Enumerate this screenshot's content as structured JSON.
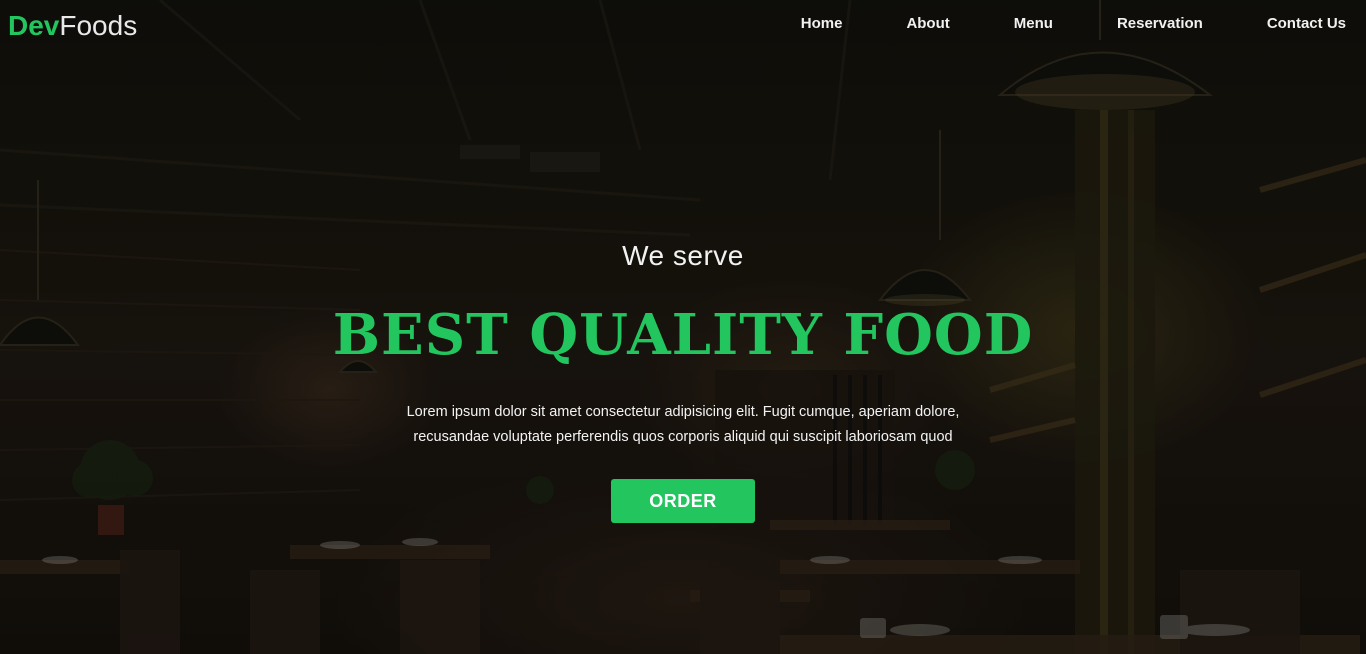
{
  "brand": {
    "part1": "Dev",
    "part2": "Foods",
    "accent_color": "#22c55e"
  },
  "nav": {
    "items": [
      {
        "label": "Home"
      },
      {
        "label": "About"
      },
      {
        "label": "Menu"
      },
      {
        "label": "Reservation"
      },
      {
        "label": "Contact Us"
      }
    ]
  },
  "hero": {
    "subtitle": "We serve",
    "title": "BEST QUALITY FOOD",
    "description_line1": "Lorem ipsum dolor sit amet consectetur adipisicing elit. Fugit cumque, aperiam dolore,",
    "description_line2": "recusandae voluptate perferendis quos corporis aliquid qui suscipit laboriosam quod",
    "button_label": "ORDER",
    "button_color": "#22c55e"
  }
}
